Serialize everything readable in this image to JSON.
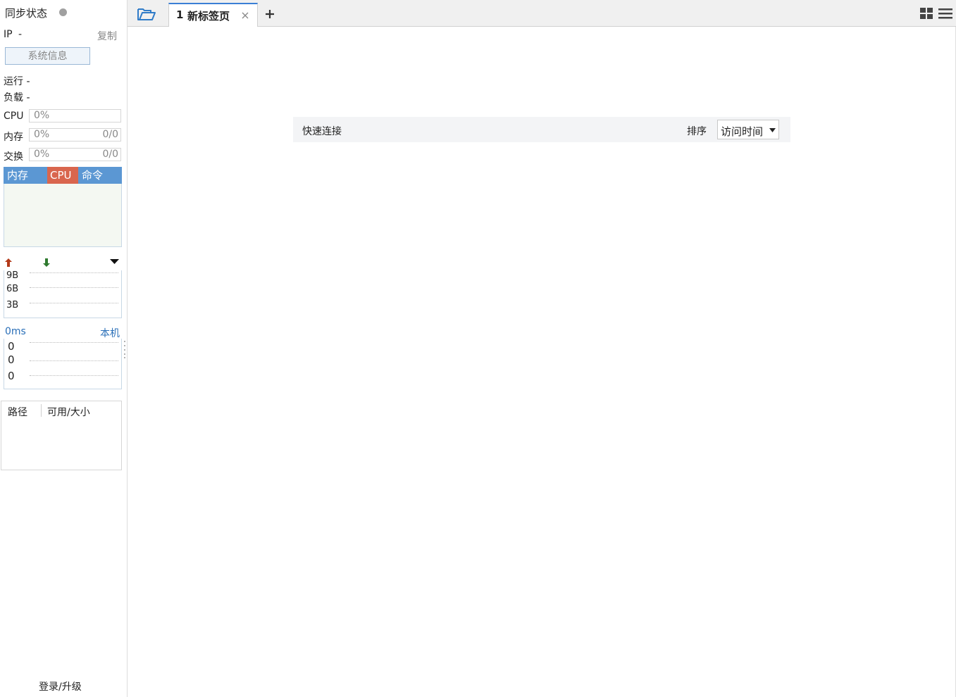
{
  "sidebar": {
    "sync_label": "同步状态",
    "ip_label": "IP",
    "ip_value": "-",
    "copy_label": "复制",
    "sysinfo_button": "系统信息",
    "uptime": "运行 -",
    "load": "负载 -",
    "cpu": {
      "label": "CPU",
      "value": "0%"
    },
    "mem": {
      "label": "内存",
      "value": "0%",
      "ratio": "0/0"
    },
    "swap": {
      "label": "交换",
      "value": "0%",
      "ratio": "0/0"
    },
    "proc_tabs": [
      "内存",
      "CPU",
      "命令"
    ],
    "net_ticks": [
      "9B",
      "6B",
      "3B"
    ],
    "latency_value": "0ms",
    "latency_target": "本机",
    "latency_ticks": [
      "0",
      "0",
      "0"
    ],
    "disk_headers": [
      "路径",
      "可用/大小"
    ],
    "login_upgrade": "登录/升级"
  },
  "tabs": {
    "active_number": "1",
    "active_title": "新标签页"
  },
  "main": {
    "quick_connect": "快速连接",
    "sort_label": "排序",
    "sort_value": "访问时间"
  },
  "colors": {
    "accent": "#3a7fd5",
    "proc_bar": "#5b97d3",
    "cpu_tab": "#d9664e",
    "latency_blue": "#2a6fb8"
  }
}
